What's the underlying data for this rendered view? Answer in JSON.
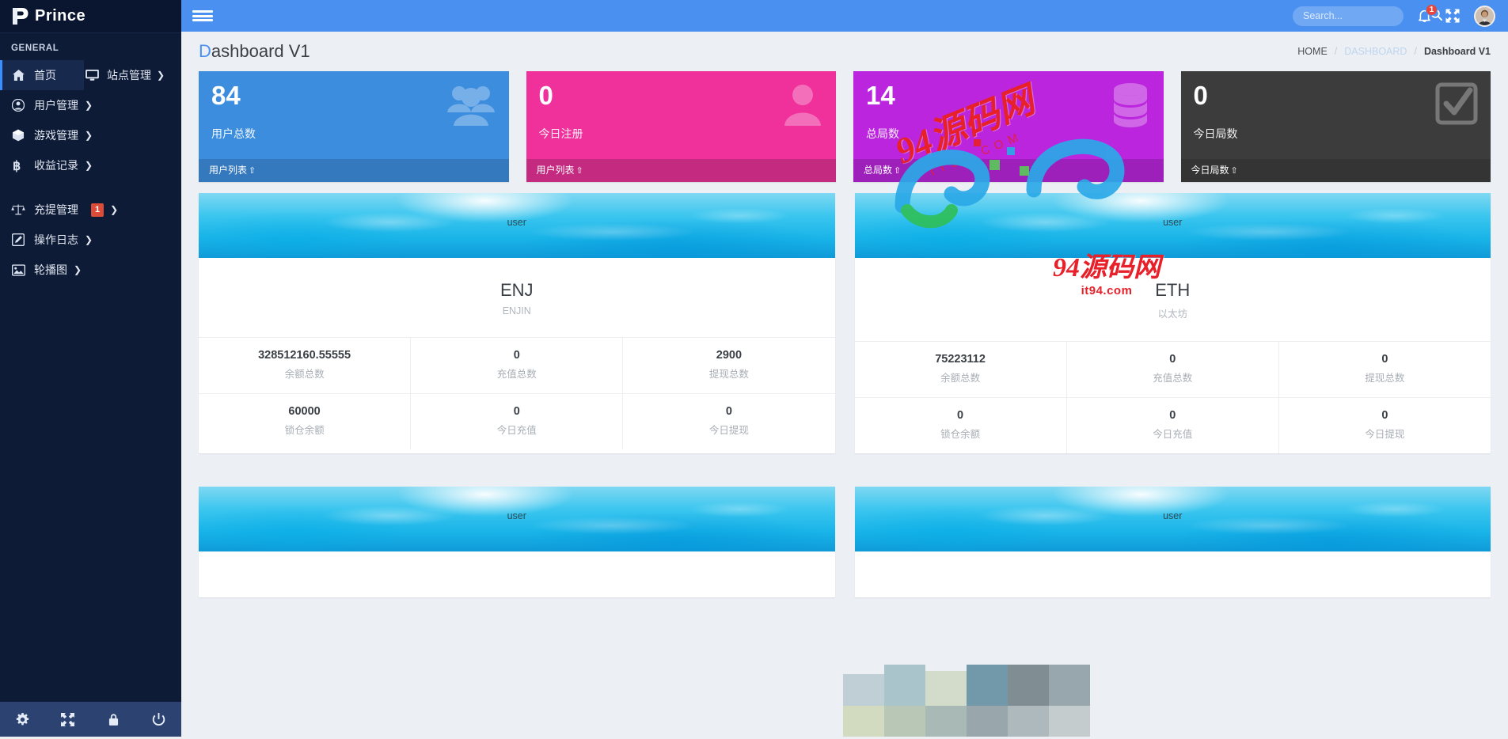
{
  "brand": {
    "name": "Prince",
    "logo_icon": "prince-p-logo"
  },
  "sidebar": {
    "section_header": "GENERAL",
    "items": [
      {
        "label": "首页",
        "icon": "home-icon",
        "active": true,
        "caret": ""
      },
      {
        "label": "站点管理",
        "icon": "monitor-icon",
        "active": false,
        "caret": "❯"
      },
      {
        "label": "用户管理",
        "icon": "user-circle-icon",
        "active": false,
        "caret": "❯"
      },
      {
        "label": "游戏管理",
        "icon": "cube-icon",
        "active": false,
        "caret": "❯"
      },
      {
        "label": "收益记录",
        "icon": "bitcoin-icon",
        "active": false,
        "caret": "❯"
      },
      {
        "label": "充提管理",
        "icon": "balance-scale-icon",
        "active": false,
        "caret": "❯",
        "badge": "1"
      },
      {
        "label": "操作日志",
        "icon": "edit-square-icon",
        "active": false,
        "caret": "❯"
      },
      {
        "label": "轮播图",
        "icon": "image-icon",
        "active": false,
        "caret": "❯"
      }
    ],
    "footer_icons": [
      "gear-icon",
      "fullscreen-icon",
      "lock-icon",
      "power-icon"
    ]
  },
  "topbar": {
    "menu_toggle_icon": "hamburger-icon",
    "search": {
      "placeholder": "Search...",
      "value": "",
      "icon": "search-icon"
    },
    "notifications": {
      "icon": "bell-icon",
      "count": "1",
      "badge_color": "#e8453c"
    },
    "fullscreen_icon": "fullscreen-arrows-icon",
    "avatar_icon": "user-avatar"
  },
  "page": {
    "title_first": "D",
    "title_rest": "ashboard V1",
    "breadcrumb": [
      {
        "label": "HOME",
        "muted": false
      },
      {
        "label": "DASHBOARD",
        "muted": true
      },
      {
        "label": "Dashboard V1",
        "current": true
      }
    ],
    "breadcrumb_separator": "/"
  },
  "stats": [
    {
      "number": "84",
      "label": "用户总数",
      "footer": "用户列表",
      "footer_icon": "cart-arrow-icon",
      "icon": "users-group-icon",
      "color": "#3c8dde",
      "foot_color": "#3479bd"
    },
    {
      "number": "0",
      "label": "今日注册",
      "footer": "用户列表",
      "footer_icon": "cart-arrow-icon",
      "icon": "user-single-icon",
      "color": "#f0319b",
      "foot_color": "#c42a80"
    },
    {
      "number": "14",
      "label": "总局数",
      "footer": "总局数",
      "footer_icon": "cart-arrow-icon",
      "icon": "database-icon",
      "color": "#bb25dd",
      "foot_color": "#9e20bb"
    },
    {
      "number": "0",
      "label": "今日局数",
      "footer": "今日局数",
      "footer_icon": "cart-arrow-icon",
      "icon": "check-square-icon",
      "color": "#3c3c3c",
      "foot_color": "#343434"
    }
  ],
  "coin_cards": [
    {
      "banner_text": "user",
      "symbol": "ENJ",
      "cn_name": "ENJIN",
      "rows": [
        [
          {
            "value": "328512160.55555",
            "caption": "余额总数"
          },
          {
            "value": "0",
            "caption": "充值总数"
          },
          {
            "value": "2900",
            "caption": "提现总数"
          }
        ],
        [
          {
            "value": "60000",
            "caption": "锁仓余额"
          },
          {
            "value": "0",
            "caption": "今日充值"
          },
          {
            "value": "0",
            "caption": "今日提现"
          }
        ]
      ]
    },
    {
      "banner_text": "user",
      "symbol": "ETH",
      "cn_name": "以太坊",
      "rows": [
        [
          {
            "value": "75223112",
            "caption": "余额总数"
          },
          {
            "value": "0",
            "caption": "充值总数"
          },
          {
            "value": "0",
            "caption": "提现总数"
          }
        ],
        [
          {
            "value": "0",
            "caption": "锁仓余额"
          },
          {
            "value": "0",
            "caption": "今日充值"
          },
          {
            "value": "0",
            "caption": "今日提现"
          }
        ]
      ]
    }
  ],
  "coin_cards_bottom": [
    {
      "banner_text": "user"
    },
    {
      "banner_text": "user"
    }
  ],
  "watermark": {
    "main_text": "94源码网",
    "sub_text": "it94.com",
    "small_text": "IT 9 4 . C O M",
    "color": "#e8202a"
  }
}
